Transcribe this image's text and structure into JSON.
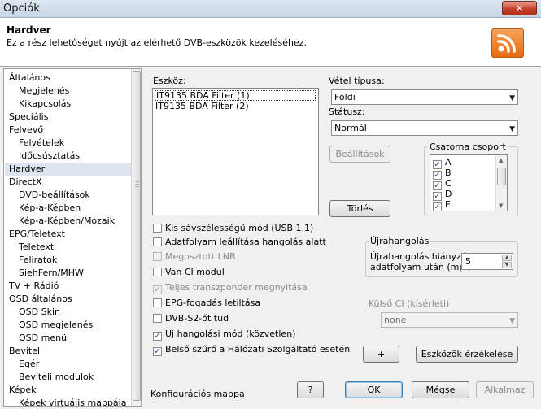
{
  "window": {
    "title": "Opciók",
    "close_label": "✕"
  },
  "header": {
    "title": "Hardver",
    "description": "Ez a rész lehetőséget nyújt az elérhető DVB-eszközök kezeléséhez."
  },
  "nav": {
    "items": [
      {
        "label": "Általános",
        "level": 0
      },
      {
        "label": "Megjelenés",
        "level": 1
      },
      {
        "label": "Kikapcsolás",
        "level": 1
      },
      {
        "label": "Speciális",
        "level": 0
      },
      {
        "label": "Felvevő",
        "level": 0
      },
      {
        "label": "Felvételek",
        "level": 1
      },
      {
        "label": "Időcsúsztatás",
        "level": 1
      },
      {
        "label": "Hardver",
        "level": 0,
        "selected": true
      },
      {
        "label": "DirectX",
        "level": 0
      },
      {
        "label": "DVD-beállítások",
        "level": 1
      },
      {
        "label": "Kép-a-Képben",
        "level": 1
      },
      {
        "label": "Kép-a-Képben/Mozaik",
        "level": 1
      },
      {
        "label": "EPG/Teletext",
        "level": 0
      },
      {
        "label": "Teletext",
        "level": 1
      },
      {
        "label": "Feliratok",
        "level": 1
      },
      {
        "label": "SiehFern/MHW",
        "level": 1
      },
      {
        "label": "TV + Rádió",
        "level": 0
      },
      {
        "label": "OSD általános",
        "level": 0
      },
      {
        "label": "OSD Skin",
        "level": 1
      },
      {
        "label": "OSD megjelenés",
        "level": 1
      },
      {
        "label": "OSD menü",
        "level": 1
      },
      {
        "label": "Bevitel",
        "level": 0
      },
      {
        "label": "Egér",
        "level": 1
      },
      {
        "label": "Beviteli modulok",
        "level": 1
      },
      {
        "label": "Képek",
        "level": 0
      },
      {
        "label": "Képek virtuális mappája",
        "level": 1
      }
    ]
  },
  "devices": {
    "label": "Eszköz:",
    "items": [
      "IT9135 BDA Filter (1)",
      "IT9135 BDA Filter (2)"
    ]
  },
  "reception": {
    "label": "Vétel típusa:",
    "value": "Földi"
  },
  "status": {
    "label": "Státusz:",
    "value": "Normál"
  },
  "buttons": {
    "settings": "Beállítások",
    "delete": "Törlés",
    "add": "+",
    "detect": "Eszközök érzékelése",
    "help": "?",
    "ok": "OK",
    "cancel": "Mégse",
    "apply": "Alkalmaz"
  },
  "channel_group": {
    "title": "Csatorna csoport",
    "items": [
      "A",
      "B",
      "C",
      "D",
      "E"
    ]
  },
  "options": [
    {
      "label": "Kis sávszélességű mód (USB 1.1)",
      "checked": false,
      "enabled": true
    },
    {
      "label": "Adatfolyam leállítása hangolás alatt",
      "checked": false,
      "enabled": true
    },
    {
      "label": "Megosztott LNB",
      "checked": false,
      "enabled": false
    },
    {
      "label": "Van CI modul",
      "checked": false,
      "enabled": true
    },
    {
      "label": "Teljes transzponder megnyitása",
      "checked": true,
      "enabled": false
    },
    {
      "label": "EPG-fogadás letiltása",
      "checked": false,
      "enabled": true
    },
    {
      "label": "DVB-S2-őt tud",
      "checked": false,
      "enabled": true
    },
    {
      "label": "Új hangolási mód (közvetlen)",
      "checked": true,
      "enabled": true
    },
    {
      "label": "Belső szűrő a Hálózati Szolgáltató esetén",
      "checked": true,
      "enabled": true
    }
  ],
  "retune": {
    "title": "Újrahangolás",
    "line1": "Újrahangolás hiányzó",
    "line2": "adatfolyam után (mp.)",
    "value": "5"
  },
  "external_ci": {
    "label": "Külső CI (kísérleti)",
    "value": "none"
  },
  "footer": {
    "config_link": "Konfigurációs mappa"
  }
}
